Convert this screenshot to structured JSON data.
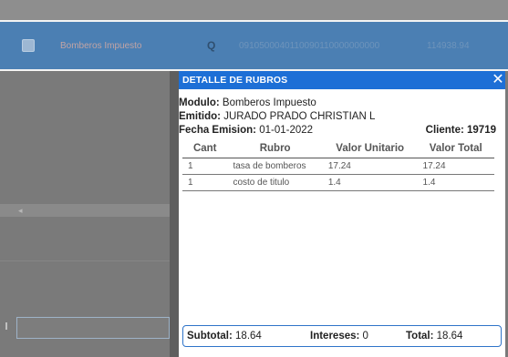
{
  "background": {
    "row_name": "Bomberos Impuesto",
    "row_code": "0910500040110090110000000000",
    "row_amount": "114938.94",
    "search_icon_glyph": "Q",
    "scroll_arrow_glyph": "◂"
  },
  "modal": {
    "title": "DETALLE DE RUBROS",
    "close_glyph": "✕",
    "modulo_label": "Modulo:",
    "modulo_value": "Bomberos Impuesto",
    "emitido_label": "Emitido:",
    "emitido_value": "JURADO PRADO CHRISTIAN L",
    "fecha_label": "Fecha Emision:",
    "fecha_value": "01-01-2022",
    "cliente_label": "Cliente:",
    "cliente_value": "19719",
    "table": {
      "headers": [
        "Cant",
        "Rubro",
        "Valor Unitario",
        "Valor Total"
      ],
      "rows": [
        {
          "cant": "1",
          "rubro": "tasa de bomberos",
          "valor_unitario": "17.24",
          "valor_total": "17.24"
        },
        {
          "cant": "1",
          "rubro": "costo de titulo",
          "valor_unitario": "1.4",
          "valor_total": "1.4"
        }
      ]
    },
    "totals": {
      "subtotal_label": "Subtotal:",
      "subtotal_value": "18.64",
      "intereses_label": "Intereses:",
      "intereses_value": "0",
      "total_label": "Total:",
      "total_value": "18.64"
    }
  },
  "colors": {
    "header_blue": "#1d6fd6",
    "row_blue": "#4b7fb3",
    "overlay_gray": "#7a7a7a"
  }
}
